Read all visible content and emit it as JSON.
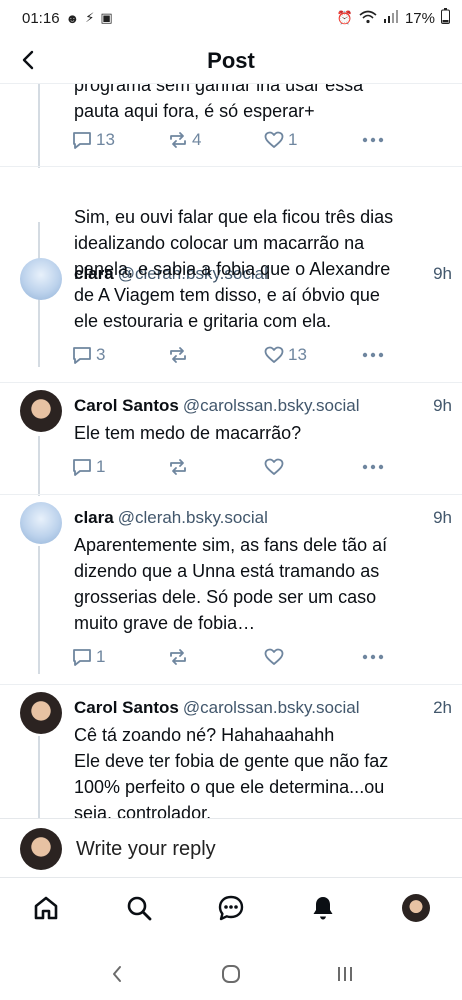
{
  "status_bar": {
    "time": "01:16",
    "battery": "17%"
  },
  "header": {
    "title": "Post"
  },
  "first_post_partial": {
    "lines": [
      "programa sem ganhar iria usar essa",
      "pauta aqui fora, é só esperar+"
    ],
    "reply_count": "13",
    "repost_count": "4",
    "like_count": "1"
  },
  "posts": [
    {
      "name": "clara",
      "handle": "@clerah.bsky.social",
      "time": "9h",
      "lines": [
        "Sim, eu ouvi falar que ela ficou três dias",
        "idealizando colocar um macarrão na",
        "panela, e sabia a fobia que o Alexandre",
        "de A Viagem tem disso, e aí óbvio que",
        "ele estouraria e gritaria com ela."
      ],
      "reply_count": "3",
      "repost_count": "",
      "like_count": "13"
    },
    {
      "name": "Carol Santos",
      "handle": "@carolssan.bsky.social",
      "time": "9h",
      "lines": [
        "Ele tem medo de macarrão?"
      ],
      "reply_count": "1",
      "repost_count": "",
      "like_count": ""
    },
    {
      "name": "clara",
      "handle": "@clerah.bsky.social",
      "time": "9h",
      "lines": [
        "Aparentemente sim, as fans dele tão aí",
        "dizendo que a Unna está tramando as",
        "grosserias dele. Só pode ser um caso",
        "muito grave de fobia…"
      ],
      "reply_count": "1",
      "repost_count": "",
      "like_count": ""
    },
    {
      "name": "Carol Santos",
      "handle": "@carolssan.bsky.social",
      "time": "2h",
      "lines": [
        "Cê tá zoando né? Hahahaahahh",
        "Ele deve ter fobia de gente que não faz",
        "100% perfeito o que ele determina...ou",
        "seja, controlador."
      ]
    }
  ],
  "reply_bar": {
    "placeholder": "Write your reply"
  },
  "nav": {
    "items": [
      "home-icon",
      "search-icon",
      "chat-icon",
      "bell-icon",
      "profile-avatar"
    ]
  },
  "colors": {
    "icon_gray": "#6f869f",
    "thread_line": "#d4dbe2",
    "handle_gray": "#42576c"
  }
}
